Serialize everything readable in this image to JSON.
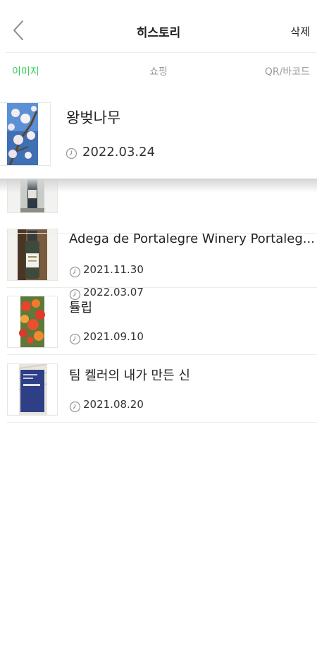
{
  "header": {
    "title": "히스토리",
    "delete_label": "삭제"
  },
  "tabs": [
    {
      "label": "이미지",
      "active": true
    },
    {
      "label": "쇼핑",
      "active": false
    },
    {
      "label": "QR/바코드",
      "active": false
    }
  ],
  "colors": {
    "accent": "#2ecc52",
    "inactive_tab": "#9a9a9a"
  },
  "history": [
    {
      "title": "왕벚나무",
      "date": "2022.03.24",
      "thumb": "cherry-blossom"
    },
    {
      "title": "",
      "date": "2022.03.07",
      "thumb": "wine-bottle-dark"
    },
    {
      "title": "Adega de Portalegre Winery Portaleg...",
      "date": "2021.11.30",
      "thumb": "wine-bottle-white-label"
    },
    {
      "title": "튤립",
      "date": "2021.09.10",
      "thumb": "tulips"
    },
    {
      "title": "팀 켈러의 내가 만든 신",
      "date": "2021.08.20",
      "thumb": "book-cover"
    }
  ]
}
